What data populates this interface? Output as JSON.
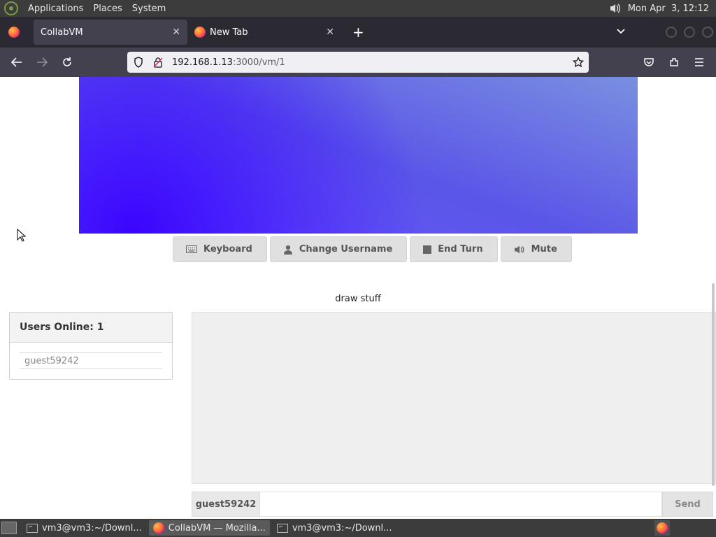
{
  "top_panel": {
    "menus": [
      "Applications",
      "Places",
      "System"
    ],
    "clock": "Mon Apr  3, 12:12"
  },
  "browser": {
    "tabs": [
      {
        "label": "CollabVM",
        "active": true
      },
      {
        "label": "New Tab",
        "active": false
      }
    ],
    "url_host": "192.168.1.13",
    "url_path": ":3000/vm/1"
  },
  "vm": {
    "buttons": {
      "keyboard": "Keyboard",
      "change_username": "Change Username",
      "end_turn": "End Turn",
      "mute": "Mute"
    },
    "title": "draw stuff"
  },
  "users": {
    "header": "Users Online: 1",
    "list": [
      "guest59242"
    ]
  },
  "chat": {
    "username": "guest59242",
    "input_placeholder": "",
    "send_label": "Send"
  },
  "taskbar": {
    "tasks": [
      {
        "label": "vm3@vm3:~/Downl...",
        "icon": "terminal-icon",
        "active": false
      },
      {
        "label": "CollabVM — Mozilla...",
        "icon": "firefox-icon",
        "active": true
      },
      {
        "label": "vm3@vm3:~/Downl...",
        "icon": "terminal-icon",
        "active": false
      }
    ]
  },
  "colors": {
    "panel_bg": "#3c3c3c",
    "browser_tab_bg": "#2b2a33",
    "browser_toolbar_bg": "#42414d",
    "vm_button_bg": "#e0e0e0"
  }
}
